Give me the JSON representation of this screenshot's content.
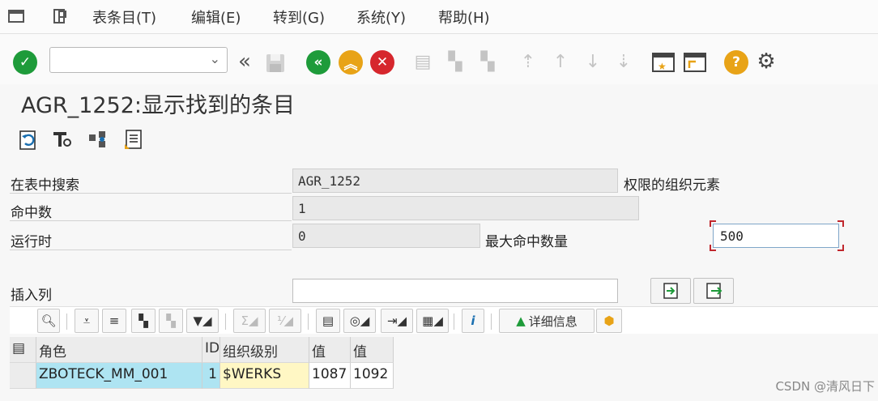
{
  "menu": {
    "items": [
      "表条目(T)",
      "编辑(E)",
      "转到(G)",
      "系统(Y)",
      "帮助(H)"
    ]
  },
  "toolbar": {
    "command_value": "",
    "icons": [
      "check-icon",
      "back-arrows-icon",
      "save-icon",
      "back-icon",
      "exit-icon",
      "cancel-icon",
      "print-icon",
      "find-icon",
      "find-next-icon",
      "first-page-icon",
      "prev-page-icon",
      "next-page-icon",
      "last-page-icon",
      "new-session-icon",
      "shortcut-icon",
      "help-icon",
      "settings-icon"
    ]
  },
  "title": "AGR_1252:显示找到的条目",
  "form": {
    "search_in_table_label": "在表中搜索",
    "search_in_table_value": "AGR_1252",
    "search_in_table_desc": "权限的组织元素",
    "hits_label": "命中数",
    "hits_value": "1",
    "runtime_label": "运行时",
    "runtime_value": "0",
    "max_hits_label": "最大命中数量",
    "max_hits_value": "500",
    "insert_column_label": "插入列",
    "insert_column_value": ""
  },
  "alv_toolbar": {
    "details_label": "详细信息"
  },
  "table": {
    "headers": [
      "角色",
      "ID",
      "组织级别",
      "值",
      "值"
    ],
    "rows": [
      [
        "ZBOTECK_MM_001",
        "1",
        "$WERKS",
        "1087",
        "1092"
      ]
    ]
  },
  "watermark": "CSDN @清风日下"
}
